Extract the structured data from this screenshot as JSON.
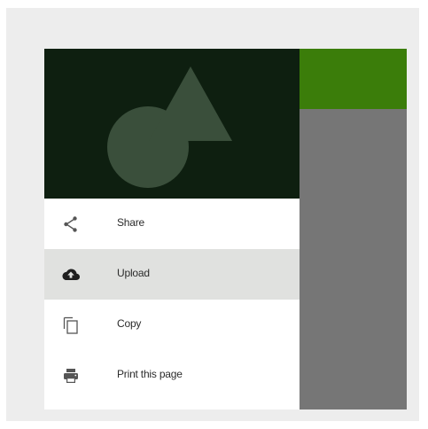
{
  "app": {
    "colors": {
      "app_bar": "#3b7d0a",
      "drawer_header": "#0e1f10",
      "active_item": "#e0e1df"
    }
  },
  "drawer": {
    "menu": [
      {
        "label": "Share",
        "icon": "share-icon"
      },
      {
        "label": "Upload",
        "icon": "cloud-upload-icon",
        "active": true
      },
      {
        "label": "Copy",
        "icon": "copy-icon"
      },
      {
        "label": "Print this page",
        "icon": "print-icon"
      }
    ]
  }
}
